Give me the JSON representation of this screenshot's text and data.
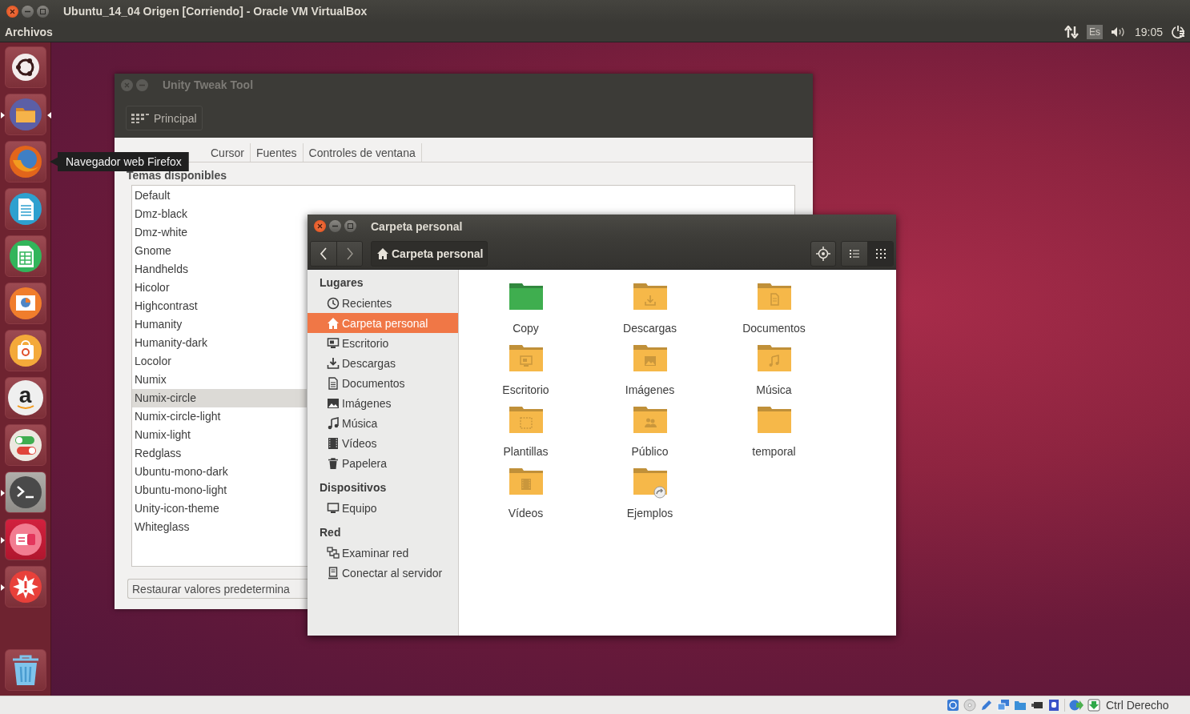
{
  "vbox": {
    "title": "Ubuntu_14_04 Origen [Corriendo] - Oracle VM VirtualBox",
    "host_key": "Ctrl Derecho"
  },
  "panel": {
    "app_name": "Archivos",
    "keyboard": "Es",
    "clock": "19:05"
  },
  "launcher": [
    {
      "kind": "ubuntu",
      "running": false,
      "focused": false
    },
    {
      "kind": "files",
      "running": true,
      "focused": true
    },
    {
      "kind": "firefox",
      "running": false,
      "focused": false
    },
    {
      "kind": "writer",
      "running": false,
      "focused": false
    },
    {
      "kind": "calc",
      "running": false,
      "focused": false
    },
    {
      "kind": "impress",
      "running": false,
      "focused": false
    },
    {
      "kind": "software",
      "running": false,
      "focused": false
    },
    {
      "kind": "amazon",
      "running": false,
      "focused": false,
      "glyph": "a"
    },
    {
      "kind": "toggles",
      "running": false,
      "focused": false
    },
    {
      "kind": "terminal",
      "running": true,
      "focused": false
    },
    {
      "kind": "pink",
      "running": true,
      "focused": false
    },
    {
      "kind": "alert",
      "running": true,
      "focused": false
    }
  ],
  "tooltip": "Navegador web Firefox",
  "tweak": {
    "title": "Unity Tweak Tool",
    "toolbar_button": "Principal",
    "tabs": [
      {
        "label": "Cursor",
        "selected": false
      },
      {
        "label": "Fuentes",
        "selected": false
      },
      {
        "label": "Controles de ventana",
        "selected": false
      }
    ],
    "section": "Temas disponibles",
    "themes": [
      {
        "name": "Default",
        "selected": false
      },
      {
        "name": "Dmz-black",
        "selected": false
      },
      {
        "name": "Dmz-white",
        "selected": false
      },
      {
        "name": "Gnome",
        "selected": false
      },
      {
        "name": "Handhelds",
        "selected": false
      },
      {
        "name": "Hicolor",
        "selected": false
      },
      {
        "name": "Highcontrast",
        "selected": false
      },
      {
        "name": "Humanity",
        "selected": false
      },
      {
        "name": "Humanity-dark",
        "selected": false
      },
      {
        "name": "Locolor",
        "selected": false
      },
      {
        "name": "Numix",
        "selected": false
      },
      {
        "name": "Numix-circle",
        "selected": true
      },
      {
        "name": "Numix-circle-light",
        "selected": false
      },
      {
        "name": "Numix-light",
        "selected": false
      },
      {
        "name": "Redglass",
        "selected": false
      },
      {
        "name": "Ubuntu-mono-dark",
        "selected": false
      },
      {
        "name": "Ubuntu-mono-light",
        "selected": false
      },
      {
        "name": "Unity-icon-theme",
        "selected": false
      },
      {
        "name": "Whiteglass",
        "selected": false
      }
    ],
    "reset_button": "Restaurar valores predetermina"
  },
  "files": {
    "title": "Carpeta personal",
    "path_button": "Carpeta personal",
    "view_buttons": [
      {
        "kind": "list",
        "selected": false
      },
      {
        "kind": "grid",
        "selected": true
      }
    ],
    "sections": [
      {
        "heading": "Lugares",
        "items": [
          {
            "label": "Recientes",
            "kind": "recent",
            "selected": false
          },
          {
            "label": "Carpeta personal",
            "kind": "home",
            "selected": true
          },
          {
            "label": "Escritorio",
            "kind": "desktop",
            "selected": false
          },
          {
            "label": "Descargas",
            "kind": "download",
            "selected": false
          },
          {
            "label": "Documentos",
            "kind": "document",
            "selected": false
          },
          {
            "label": "Imágenes",
            "kind": "image",
            "selected": false
          },
          {
            "label": "Música",
            "kind": "music",
            "selected": false
          },
          {
            "label": "Vídeos",
            "kind": "video",
            "selected": false
          },
          {
            "label": "Papelera",
            "kind": "trash",
            "selected": false
          }
        ]
      },
      {
        "heading": "Dispositivos",
        "items": [
          {
            "label": "Equipo",
            "kind": "computer",
            "selected": false
          }
        ]
      },
      {
        "heading": "Red",
        "items": [
          {
            "label": "Examinar red",
            "kind": "network",
            "selected": false
          },
          {
            "label": "Conectar al servidor",
            "kind": "server",
            "selected": false
          }
        ]
      }
    ],
    "folders": [
      {
        "name": "Copy",
        "kind": "plain",
        "color": "#3fae4f"
      },
      {
        "name": "Descargas",
        "kind": "download",
        "color": "#f6b849"
      },
      {
        "name": "Documentos",
        "kind": "document",
        "color": "#f6b849"
      },
      {
        "name": "Escritorio",
        "kind": "desktop",
        "color": "#f6b849"
      },
      {
        "name": "Imágenes",
        "kind": "image",
        "color": "#f6b849"
      },
      {
        "name": "Música",
        "kind": "music",
        "color": "#f6b849"
      },
      {
        "name": "Plantillas",
        "kind": "template",
        "color": "#f6b849"
      },
      {
        "name": "Público",
        "kind": "public",
        "color": "#f6b849"
      },
      {
        "name": "temporal",
        "kind": "plain",
        "color": "#f6b849"
      },
      {
        "name": "Vídeos",
        "kind": "video",
        "color": "#f6b849"
      },
      {
        "name": "Ejemplos",
        "kind": "link",
        "color": "#f6b849"
      }
    ]
  }
}
